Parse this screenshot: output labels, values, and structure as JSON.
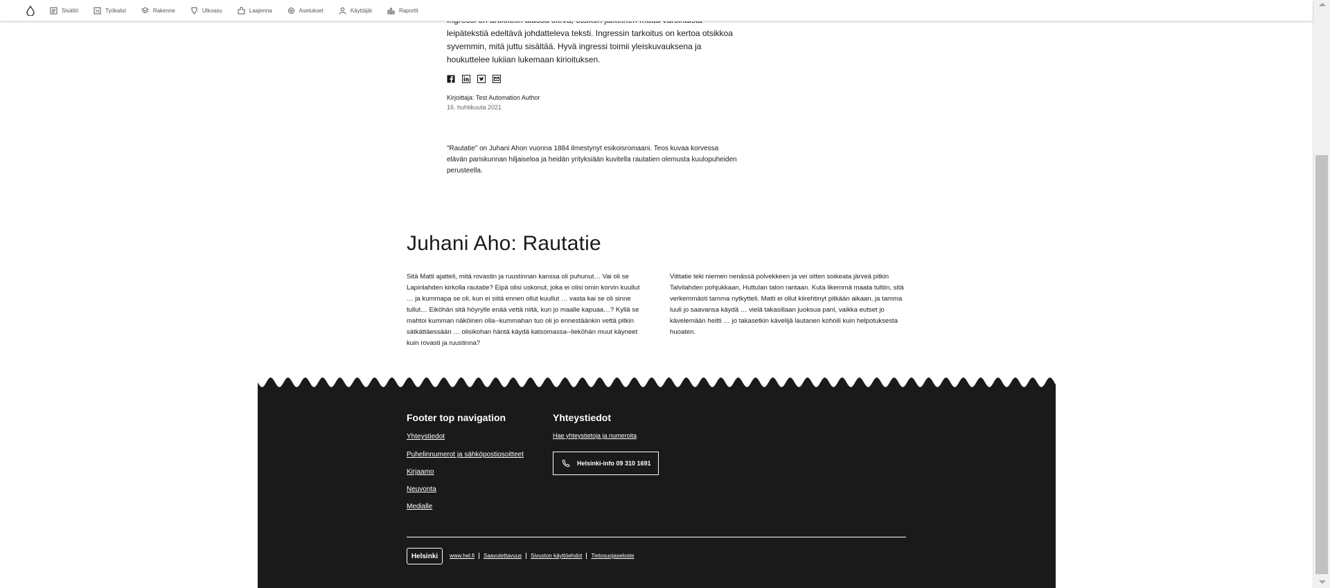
{
  "toolbar": {
    "items": [
      {
        "label": "Sisältö",
        "icon": "document-icon"
      },
      {
        "label": "Työkalut",
        "icon": "wrench-icon"
      },
      {
        "label": "Rakenne",
        "icon": "layers-icon"
      },
      {
        "label": "Ulkoasu",
        "icon": "paint-icon"
      },
      {
        "label": "Laajenna",
        "icon": "puzzle-icon"
      },
      {
        "label": "Asetukset",
        "icon": "gear-icon"
      },
      {
        "label": "Käyttäjät",
        "icon": "user-icon"
      },
      {
        "label": "Raportit",
        "icon": "chart-icon"
      }
    ]
  },
  "article": {
    "lead_text": "Ingressi on artikkelin alussa oleva, otsikon jälkeinen mutta varsinaista leipätekstiä edeltävä johdatteleva teksti. Ingressin tarkoitus on kertoa otsikkoa syvemmin, mitä juttu sisältää. Hyvä ingressi toimii yleiskuvauksena ja houkuttelee lukijan lukemaan kirjoituksen.",
    "share_icons": [
      "facebook-icon",
      "linkedin-icon",
      "twitter-icon",
      "email-icon"
    ],
    "author": "Kirjoittaja: Test Automation Author",
    "date": "16. huhtikuuta 2021",
    "intro": "\"Rautatie\" on Juhani Ahon vuonna 1884 ilmestynyt esikoisromaani. Teos kuvaa korvessa elävän pariskunnan hiljaiseloa ja heidän yrityksiään kuvitella rautatien olemusta kuulopuheiden perusteella.",
    "heading": "Juhani Aho: Rautatie",
    "col_left": "Sitä Matti ajatteli, mitä rovastin ja ruustinnan kanssa oli puhunut… Vai oli se Lapinlahden kirkolla rautatie? Eipä olisi uskonut, joka ei olisi omin korvin kuullut … ja kummapa se oli, kun ei siitä ennen ollut kuullut … vasta kai se oli sinne tullut… Eiköhän sitä höyrylle enää vettä niitä, kun jo maalle kapuaa…? Kyllä se mahtoi kumman näköinen olla--kummahan tuo oli jo ennestäänkin vettä pitkin sätkättäessään … olisikohan häntä käydä katsomassa--liekōhän muut käyneet kuin rovasti ja ruustinna?",
    "col_right": " Viittatie teki niemen nenässä polvekkeen ja vei sitten soikeata järveä pitkin Talvilahden pohjukkaan, Huttulan talon rantaan. Kuta likemmä maata tultiin, sitä verkemmästi tamma nytkytteli. Matti ei ollut kiirehtinyt pitkään aikaan, ja tamma luuli jo saavansa käydä … vielä takasillaan juoksua pani, vaikka eutset jo kävelemään heitti … jo takasetkin kävelijä lautanen kohoili kuin helpotuksesta huoaten."
  },
  "footer": {
    "nav_title": "Footer top navigation",
    "nav_links": [
      "Yhteystiedot",
      "Puhelinnumerot ja sähköpostiosoitteet",
      "Kirjaamo",
      "Neuvonta",
      "Medialle"
    ],
    "contact_title": "Yhteystiedot",
    "contact_link": "Hae yhteystietoja ja numeroita",
    "phone_button": "Helsinki-info 09 310 1691",
    "logo_text": "Helsinki",
    "bottom_links": [
      "www.hel.fi",
      "Saavutettavuus",
      "Sivuston käyttöehdot",
      "Tietosuojaseloste"
    ]
  },
  "colors": {
    "footer_bg": "#1a1a1a",
    "text": "#1a1a1a",
    "toolbar_text": "#55565b"
  }
}
